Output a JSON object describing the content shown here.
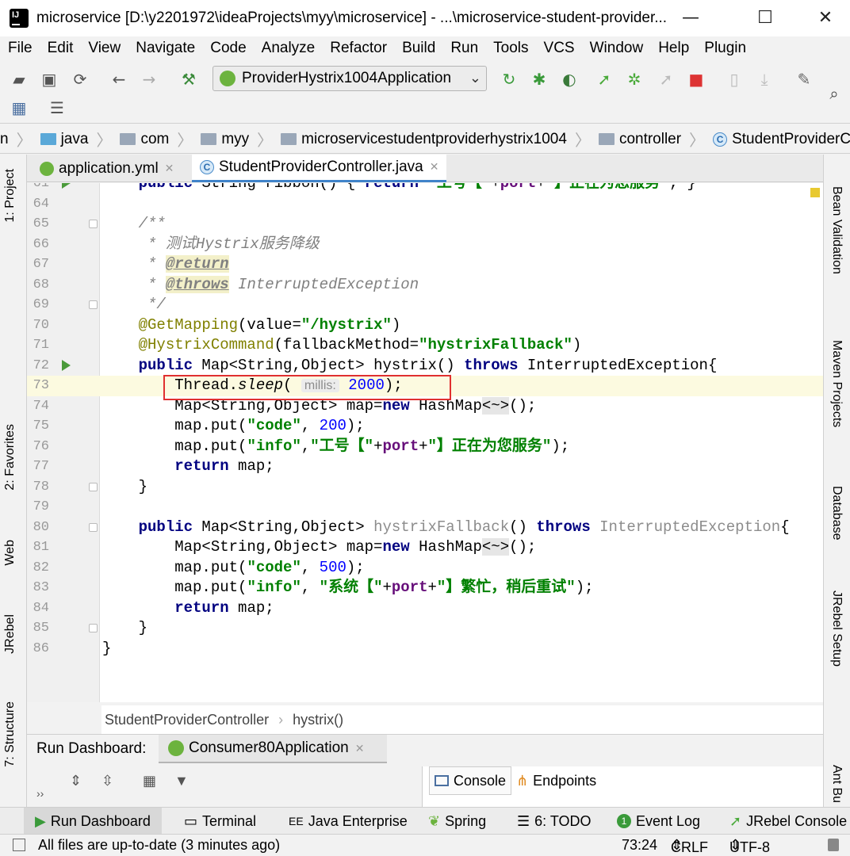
{
  "window": {
    "title": "microservice [D:\\y2201972\\ideaProjects\\myy\\microservice] - ...\\microservice-student-provider...",
    "minimize": "—",
    "maximize": "☐",
    "close": "✕"
  },
  "menu": [
    "File",
    "Edit",
    "View",
    "Navigate",
    "Code",
    "Analyze",
    "Refactor",
    "Build",
    "Run",
    "Tools",
    "VCS",
    "Window",
    "Help",
    "Plugin"
  ],
  "toolbar": {
    "run_config": "ProviderHystrix1004Application"
  },
  "breadcrumbs": [
    "java",
    "com",
    "myy",
    "microservicestudentproviderhystrix1004",
    "controller",
    "StudentProviderController"
  ],
  "breadcrumb_prefix": "n",
  "tabs": [
    {
      "label": "application.yml"
    },
    {
      "label": "StudentProviderController.java"
    }
  ],
  "left_tools": [
    "1: Project",
    "2: Favorites",
    "Web",
    "JRebel",
    "7: Structure"
  ],
  "right_tools": [
    "Bean Validation",
    "Maven Projects",
    "Database",
    "JRebel Setup",
    "Ant Bu"
  ],
  "code_lines": [
    {
      "n": "61",
      "html": "    <span class=\"kw\">public</span> String ribbon() { <span class=\"kw\">return</span> <span class=\"str\">\"工号【\"</span>+<span class=\"fld\">port</span>+<span class=\"str\">\"】正在为您服务\"</span>; }"
    },
    {
      "n": "64",
      "html": ""
    },
    {
      "n": "65",
      "html": "    <span class=\"cmt\">/**</span>"
    },
    {
      "n": "66",
      "html": "    <span class=\"cmt\"> * 测试Hystrix服务降级</span>"
    },
    {
      "n": "67",
      "html": "    <span class=\"cmt\"> * </span><span class=\"tag\">@return</span>"
    },
    {
      "n": "68",
      "html": "    <span class=\"cmt\"> * </span><span class=\"tag\">@throws</span><span class=\"cmt\"> InterruptedException</span>"
    },
    {
      "n": "69",
      "html": "    <span class=\"cmt\"> */</span>"
    },
    {
      "n": "70",
      "html": "    <span class=\"ann\">@GetMapping</span>(value=<span class=\"str\">\"/hystrix\"</span>)"
    },
    {
      "n": "71",
      "html": "    <span class=\"ann\">@HystrixCommand</span>(fallbackMethod=<span class=\"str\">\"hystrixFallback\"</span>)"
    },
    {
      "n": "72",
      "html": "    <span class=\"kw\">public</span> Map&lt;String,Object&gt; hystrix() <span class=\"kw\">throws</span> InterruptedException{"
    },
    {
      "n": "73",
      "html": "        Thread.<i>sleep</i>( <span class=\"hint\">millis:</span> <span class=\"num\">2000</span>);"
    },
    {
      "n": "74",
      "html": "        Map&lt;String,Object&gt; map=<span class=\"kw\">new</span> HashMap<span style=\"background:#e6e6e6\">&lt;~&gt;</span>();"
    },
    {
      "n": "75",
      "html": "        map.put(<span class=\"str\">\"code\"</span>, <span class=\"num\">200</span>);"
    },
    {
      "n": "76",
      "html": "        map.put(<span class=\"str\">\"info\"</span>,<span class=\"str\">\"工号【\"</span>+<span class=\"fld\">port</span>+<span class=\"str\">\"】正在为您服务\"</span>);"
    },
    {
      "n": "77",
      "html": "        <span class=\"kw\">return</span> map;"
    },
    {
      "n": "78",
      "html": "    }"
    },
    {
      "n": "79",
      "html": ""
    },
    {
      "n": "80",
      "html": "    <span class=\"kw\">public</span> Map&lt;String,Object&gt; <span class=\"grey\">hystrixFallback</span>() <span class=\"kw\">throws</span> <span class=\"grey\">InterruptedException</span>{"
    },
    {
      "n": "81",
      "html": "        Map&lt;String,Object&gt; map=<span class=\"kw\">new</span> HashMap<span style=\"background:#e6e6e6\">&lt;~&gt;</span>();"
    },
    {
      "n": "82",
      "html": "        map.put(<span class=\"str\">\"code\"</span>, <span class=\"num\">500</span>);"
    },
    {
      "n": "83",
      "html": "        map.put(<span class=\"str\">\"info\"</span>, <span class=\"str\">\"系统【\"</span>+<span class=\"fld\">port</span>+<span class=\"str\">\"】繁忙，稍后重试\"</span>);"
    },
    {
      "n": "84",
      "html": "        <span class=\"kw\">return</span> map;"
    },
    {
      "n": "85",
      "html": "    }"
    },
    {
      "n": "86",
      "html": "}"
    }
  ],
  "editor_footer": {
    "class_name": "StudentProviderController",
    "method": "hystrix()"
  },
  "run_dashboard": {
    "title": "Run Dashboard:",
    "app_tab": "Consumer80Application",
    "console_tab": "Console",
    "endpoints_tab": "Endpoints"
  },
  "bottom_tabs": [
    "Run Dashboard",
    "Terminal",
    "Java Enterprise",
    "Spring",
    "6: TODO",
    "Event Log",
    "JRebel Console"
  ],
  "status": {
    "message": "All files are up-to-date (3 minutes ago)",
    "position": "73:24",
    "line_sep": "CRLF",
    "encoding": "UTF-8"
  }
}
